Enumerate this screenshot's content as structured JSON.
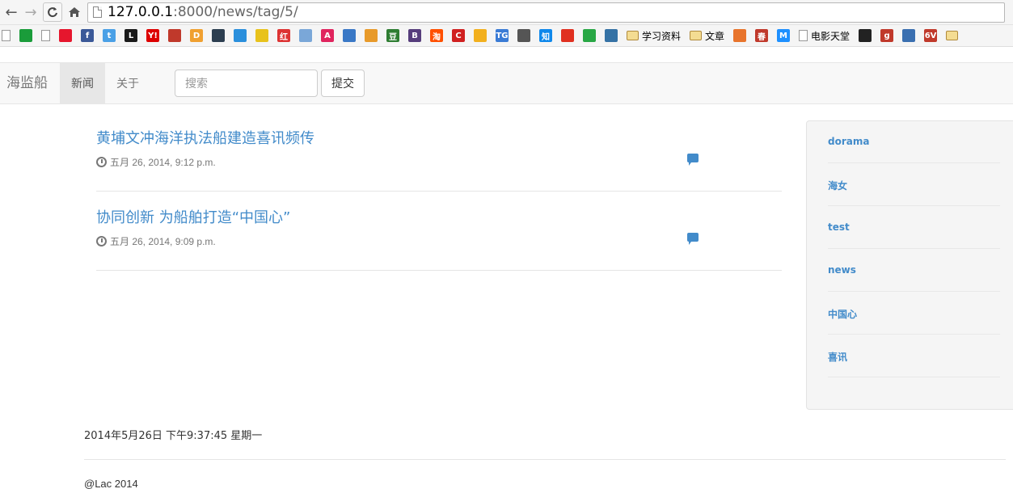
{
  "browser": {
    "url_host": "127.0.0.1",
    "url_path": ":8000/news/tag/5/",
    "bookmarks": [
      {
        "icon": "doc-icon",
        "label": ""
      },
      {
        "icon": "green-bubble-icon",
        "label": "",
        "color": "#1a9c3a"
      },
      {
        "icon": "doc-icon",
        "label": ""
      },
      {
        "icon": "weibo-icon",
        "label": "",
        "color": "#e6162d"
      },
      {
        "icon": "facebook-icon",
        "label": "f",
        "color": "#3b5998"
      },
      {
        "icon": "twitter-icon",
        "label": "t",
        "color": "#4aa0e6"
      },
      {
        "icon": "lol-icon",
        "label": "L",
        "color": "#1a1a1a"
      },
      {
        "icon": "yahoo-icon",
        "label": "Y!",
        "color": "#d00"
      },
      {
        "icon": "bookmark-red-icon",
        "label": "",
        "color": "#c0392b"
      },
      {
        "icon": "d-icon",
        "label": "D",
        "color": "#f0a030"
      },
      {
        "icon": "film-icon",
        "label": "",
        "color": "#2c3e50"
      },
      {
        "icon": "xunlei-icon",
        "label": "",
        "color": "#2a8fdc"
      },
      {
        "icon": "yellow-x-icon",
        "label": "",
        "color": "#e8c21c"
      },
      {
        "icon": "hong-icon",
        "label": "红",
        "color": "#d33"
      },
      {
        "icon": "dots-icon",
        "label": "",
        "color": "#7aa7d8"
      },
      {
        "icon": "a-icon",
        "label": "A",
        "color": "#e0245e"
      },
      {
        "icon": "image-icon",
        "label": "",
        "color": "#3a78c6"
      },
      {
        "icon": "fox-icon",
        "label": "",
        "color": "#e89a2a"
      },
      {
        "icon": "douban-icon",
        "label": "豆",
        "color": "#2e7d32"
      },
      {
        "icon": "b-icon",
        "label": "B",
        "color": "#563d7c"
      },
      {
        "icon": "taobao-icon",
        "label": "淘",
        "color": "#ff5000"
      },
      {
        "icon": "c-icon",
        "label": "C",
        "color": "#d02020"
      },
      {
        "icon": "star-icon",
        "label": "",
        "color": "#f2b01e"
      },
      {
        "icon": "tg-icon",
        "label": "TG",
        "color": "#3a7bd5"
      },
      {
        "icon": "robot-icon",
        "label": "",
        "color": "#555"
      },
      {
        "icon": "zhihu-icon",
        "label": "知",
        "color": "#0f88eb"
      },
      {
        "icon": "plus-red-icon",
        "label": "",
        "color": "#e03020"
      },
      {
        "icon": "green-rect-icon",
        "label": "",
        "color": "#28a745"
      },
      {
        "icon": "python-icon",
        "label": "",
        "color": "#3572a5"
      },
      {
        "icon": "folder-icon",
        "label": "学习资料"
      },
      {
        "icon": "folder-icon",
        "label": "文章"
      },
      {
        "icon": "flower-icon",
        "label": "",
        "color": "#e8742c"
      },
      {
        "icon": "chun-icon",
        "label": "春",
        "color": "#c0392b"
      },
      {
        "icon": "m-icon",
        "label": "M",
        "color": "#1e90ff"
      },
      {
        "icon": "doc-icon",
        "label": "电影天堂"
      },
      {
        "icon": "cat-icon",
        "label": "",
        "color": "#222"
      },
      {
        "icon": "g-icon",
        "label": "g",
        "color": "#c0392b"
      },
      {
        "icon": "tv-icon",
        "label": "",
        "color": "#3a6fb0"
      },
      {
        "icon": "6v-icon",
        "label": "6V",
        "color": "#c0392b"
      },
      {
        "icon": "folder-icon",
        "label": ""
      }
    ]
  },
  "site": {
    "brand": "海监船",
    "nav": [
      {
        "label": "新闻",
        "active": true
      },
      {
        "label": "关于",
        "active": false
      }
    ],
    "search_placeholder": "搜索",
    "submit_label": "提交"
  },
  "posts": [
    {
      "title": "黄埔文冲海洋执法船建造喜讯频传",
      "date": "五月 26, 2014, 9:12 p.m."
    },
    {
      "title": "协同创新 为船舶打造“中国心”",
      "date": "五月 26, 2014, 9:09 p.m."
    }
  ],
  "tags": [
    "dorama",
    "海女",
    "test",
    "news",
    "中国心",
    "喜讯"
  ],
  "footer": {
    "datetime": "2014年5月26日 下午9:37:45 星期一",
    "copyright": "@Lac 2014"
  }
}
